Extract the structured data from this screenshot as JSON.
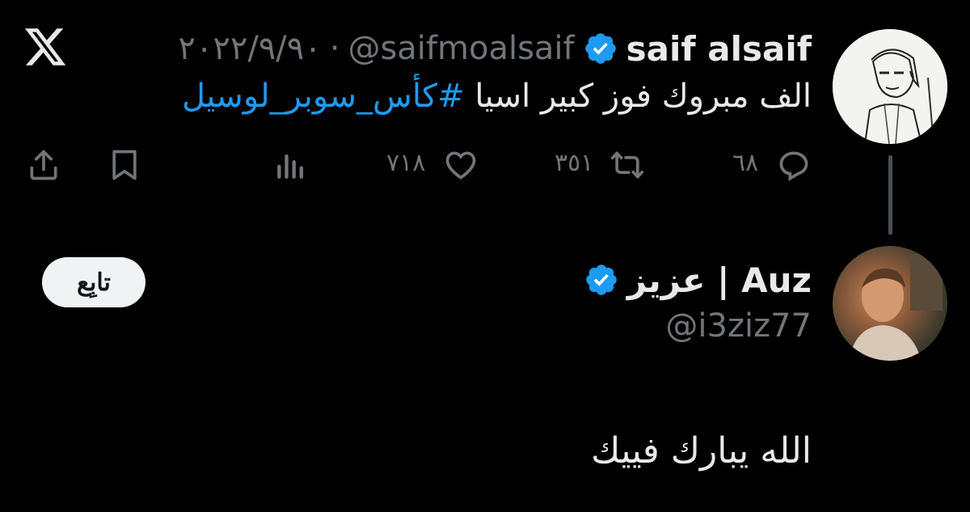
{
  "app": {
    "logo_icon": "x-logo-icon"
  },
  "tweet": {
    "author_name": "saif alsaif",
    "author_handle": "@saifmoalsaif",
    "separator": "·",
    "date": "٢٠٢٢/٩/٩٠",
    "text": "الف مبروك فوز كبير اسيا ",
    "hashtag": "#كأس_سوبر_لوسيل",
    "replies": "٦٨",
    "retweets": "٣٥١",
    "likes": "٧١٨",
    "icons": {
      "reply": "reply-icon",
      "retweet": "retweet-icon",
      "like": "heart-icon",
      "views": "views-icon",
      "bookmark": "bookmark-icon",
      "share": "share-icon",
      "verified": "verified-badge-icon"
    }
  },
  "reply": {
    "author_name": "عزيز | Auz",
    "author_handle": "@i3ziz77",
    "follow_label": "تابِع",
    "text": "الله يبارك فييك"
  },
  "colors": {
    "background": "#000000",
    "text": "#e7e9ea",
    "muted": "#71767b",
    "accent": "#1d9bf0"
  }
}
